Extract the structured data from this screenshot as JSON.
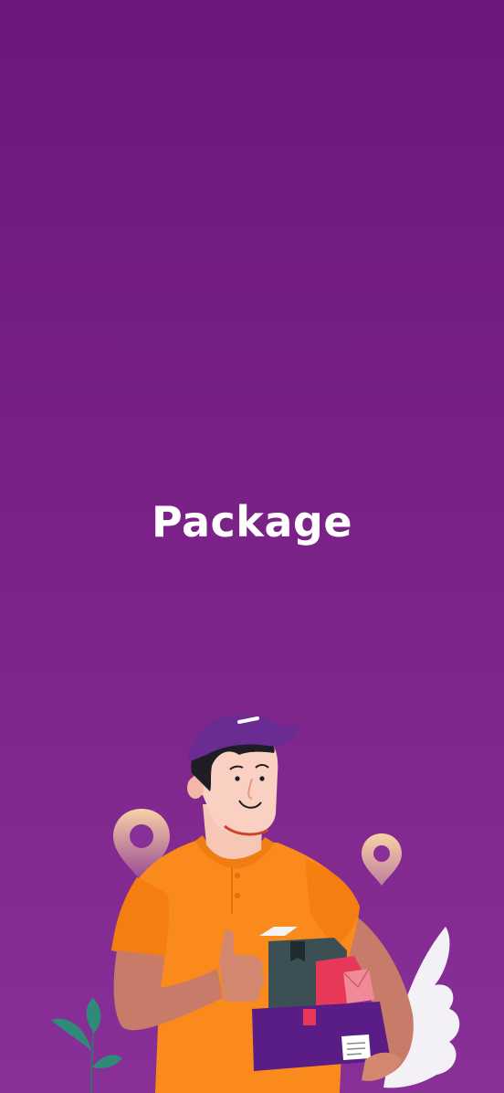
{
  "splash": {
    "app_title": "Package",
    "illustration": "delivery-man-with-packages",
    "colors": {
      "background_top": "#6d177c",
      "background_bottom": "#883097",
      "title": "#ffffff",
      "shirt": "#fb8a1c",
      "cap": "#6a2c92",
      "pin": "#f6c99a"
    }
  }
}
